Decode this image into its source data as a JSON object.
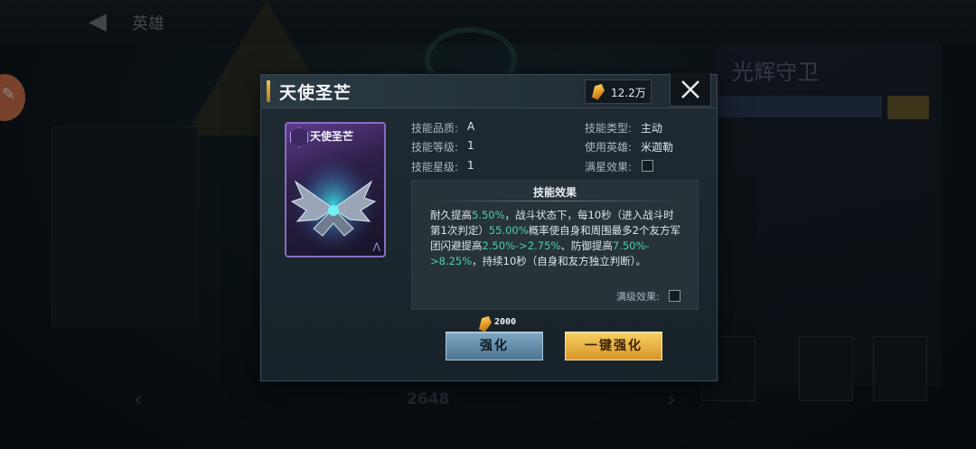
{
  "background": {
    "screen_title": "英雄",
    "hero_name": "光辉守卫",
    "bottom_count": "2648"
  },
  "dialog": {
    "title": "天使圣芒",
    "currency_value": "12.2万",
    "card_name": "天使圣芒",
    "info": {
      "quality_label": "技能品质:",
      "quality_value": "A",
      "type_label": "技能类型:",
      "type_value": "主动",
      "level_label": "技能等级:",
      "level_value": "1",
      "hero_label": "使用英雄:",
      "hero_value": "米迦勒",
      "star_label": "技能星级:",
      "star_value": "1",
      "full_star_label": "满星效果:"
    },
    "effect": {
      "title": "技能效果",
      "t1": "耐久提高",
      "v1": "5.50%",
      "t2": "，战斗状态下，每10秒（进入战斗时第1次判定）",
      "v2": "55.00%",
      "t3": "概率使自身和周围最多2个友方军团闪避提高",
      "v3": "2.50%->2.75%",
      "t4": "、防御提高",
      "v4": "7.50%->8.25%",
      "t5": "，持续10秒（自身和友方独立判断）。",
      "max_level_label": "满级效果:"
    },
    "cost_value": "2000",
    "upgrade_label": "强化",
    "oneclick_label": "一键强化",
    "colors": {
      "highlight": "#4fd0a6",
      "gold": "#e8a83a",
      "card_purple": "#8a6cc2"
    }
  }
}
